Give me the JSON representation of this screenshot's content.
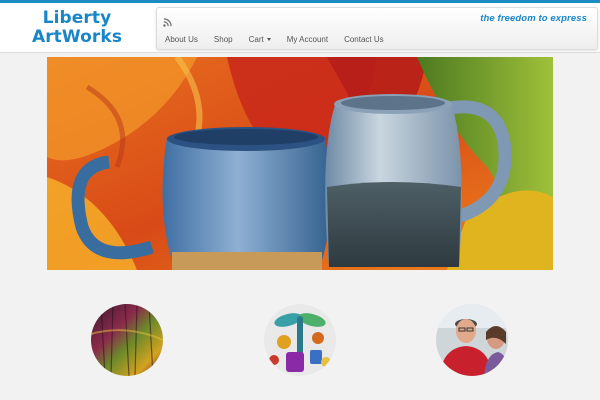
{
  "site": {
    "logo_line1": "Liberty",
    "logo_line2": "ArtWorks",
    "tagline": "the freedom to express"
  },
  "nav": {
    "items": [
      {
        "label": "About Us",
        "has_dropdown": false
      },
      {
        "label": "Shop",
        "has_dropdown": false
      },
      {
        "label": "Cart",
        "has_dropdown": true
      },
      {
        "label": "My Account",
        "has_dropdown": false
      },
      {
        "label": "Contact Us",
        "has_dropdown": false
      }
    ],
    "rss_icon": "rss-icon"
  },
  "hero": {
    "icon": "ceramic-mugs-image"
  },
  "features": [
    {
      "icon": "textured-painting-image"
    },
    {
      "icon": "glass-dragonfly-art-image"
    },
    {
      "icon": "artists-portrait-image"
    }
  ],
  "colors": {
    "accent": "#1a86c7",
    "top_bar": "#1b8bc3",
    "page_background": "#f2f2f2"
  }
}
